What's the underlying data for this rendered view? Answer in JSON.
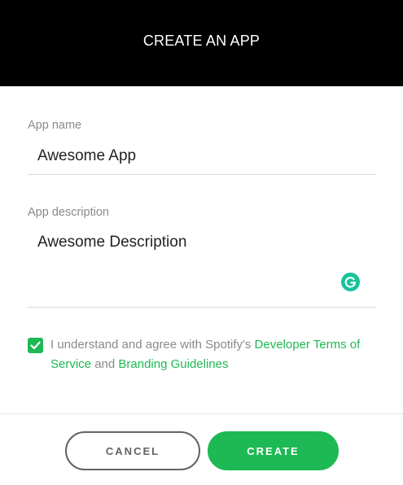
{
  "dialog": {
    "title": "CREATE AN APP"
  },
  "form": {
    "name_label": "App name",
    "name_value": "Awesome App",
    "description_label": "App description",
    "description_value": "Awesome Description",
    "grammarly_icon": "grammarly-icon"
  },
  "agreement": {
    "checked": true,
    "text_before": "I understand and agree with Spotify's ",
    "link_terms": "Developer Terms of Service",
    "text_and": " and ",
    "link_branding": "Branding Guidelines"
  },
  "actions": {
    "cancel_label": "CANCEL",
    "create_label": "CREATE"
  },
  "colors": {
    "accent": "#1db954",
    "header_bg": "#000000",
    "label_gray": "#8a8a8a",
    "cancel_border": "#616467",
    "grammarly": "#15c39a"
  }
}
